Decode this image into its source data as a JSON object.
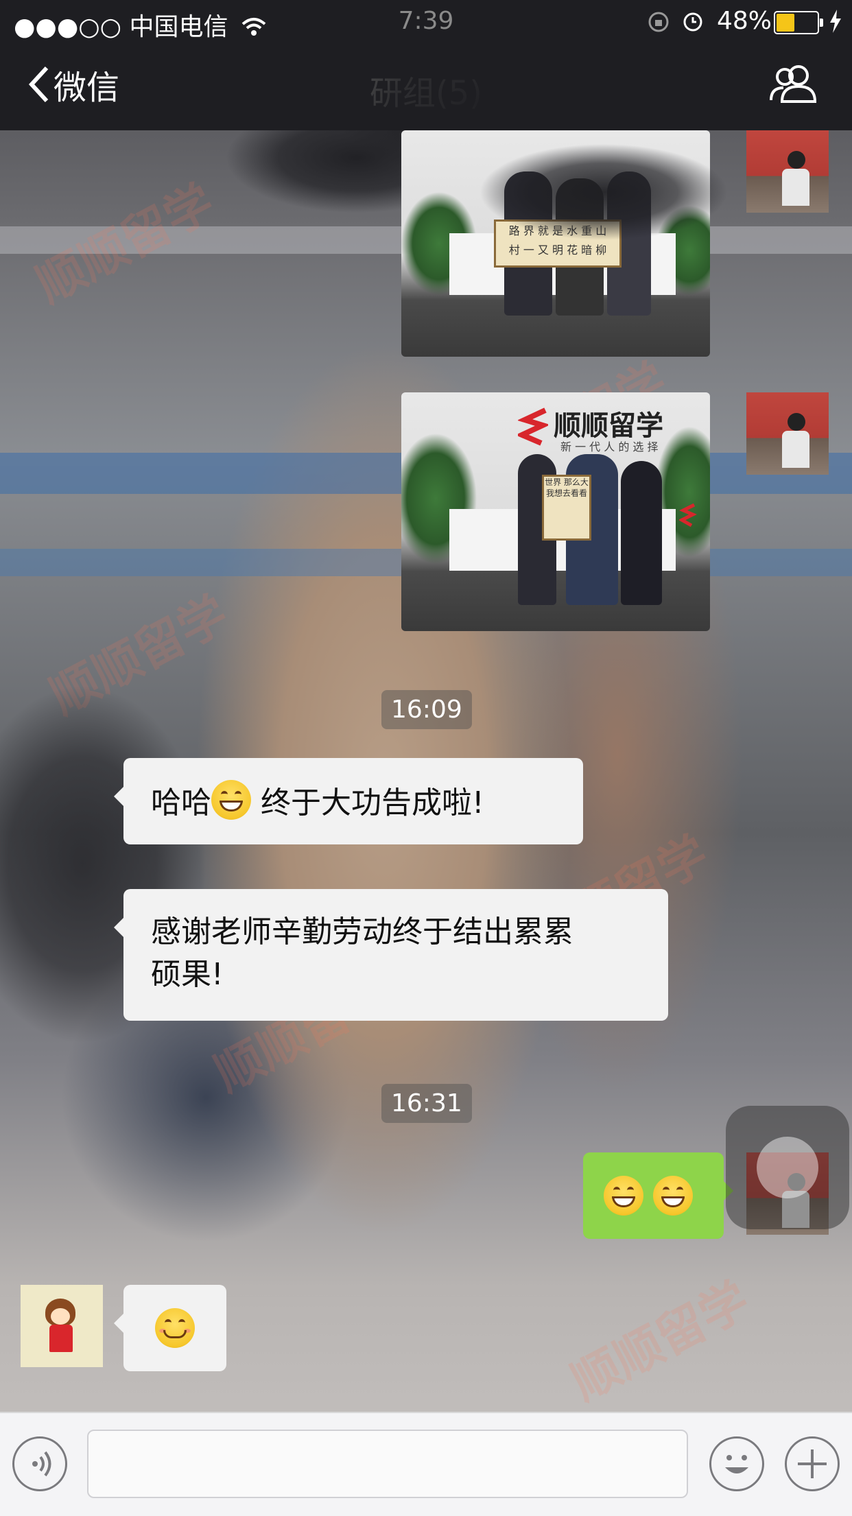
{
  "status_bar": {
    "signal": "●●●○○",
    "carrier": "中国电信",
    "time": "7:39",
    "battery": "48%",
    "battery_level": 0.48,
    "battery_color": "#f5c518"
  },
  "nav": {
    "back_label": "微信",
    "back_icon": "chevron-left-icon",
    "title": "研组(5)",
    "contacts_icon": "group-contacts-icon"
  },
  "photos": [
    {
      "sign_line1": "路 界 就 是 水 重 山",
      "sign_line2": "村 一 又 明 花 暗 柳"
    },
    {
      "logo": "顺顺留学",
      "slogan": "新 一 代 人 的 选 择",
      "sign_text": "世界 那么大 我想去看看"
    }
  ],
  "messages": [
    {
      "type": "timestamp",
      "text": "16:09"
    },
    {
      "type": "text",
      "side": "left",
      "text_before": "哈哈",
      "emoji": "grin-emoji",
      "text_after": " 终于大功告成啦!"
    },
    {
      "type": "text",
      "side": "left",
      "line1": "感谢老师辛勤劳动终于结出累累",
      "line2": "硕果!"
    },
    {
      "type": "timestamp",
      "text": "16:31"
    },
    {
      "type": "emoji",
      "side": "right",
      "emojis": [
        "grin-emoji",
        "grin-emoji"
      ]
    },
    {
      "type": "emoji",
      "side": "left",
      "emojis": [
        "smile-emoji"
      ]
    }
  ],
  "input_bar": {
    "voice_icon": "voice-icon",
    "emoji_icon": "emoji-face-icon",
    "plus_icon": "plus-icon"
  },
  "watermark": "顺顺留学",
  "colors": {
    "nav_bg": "#1e1e22",
    "bubble_white": "#f2f2f2",
    "bubble_green": "#8ed44a"
  }
}
